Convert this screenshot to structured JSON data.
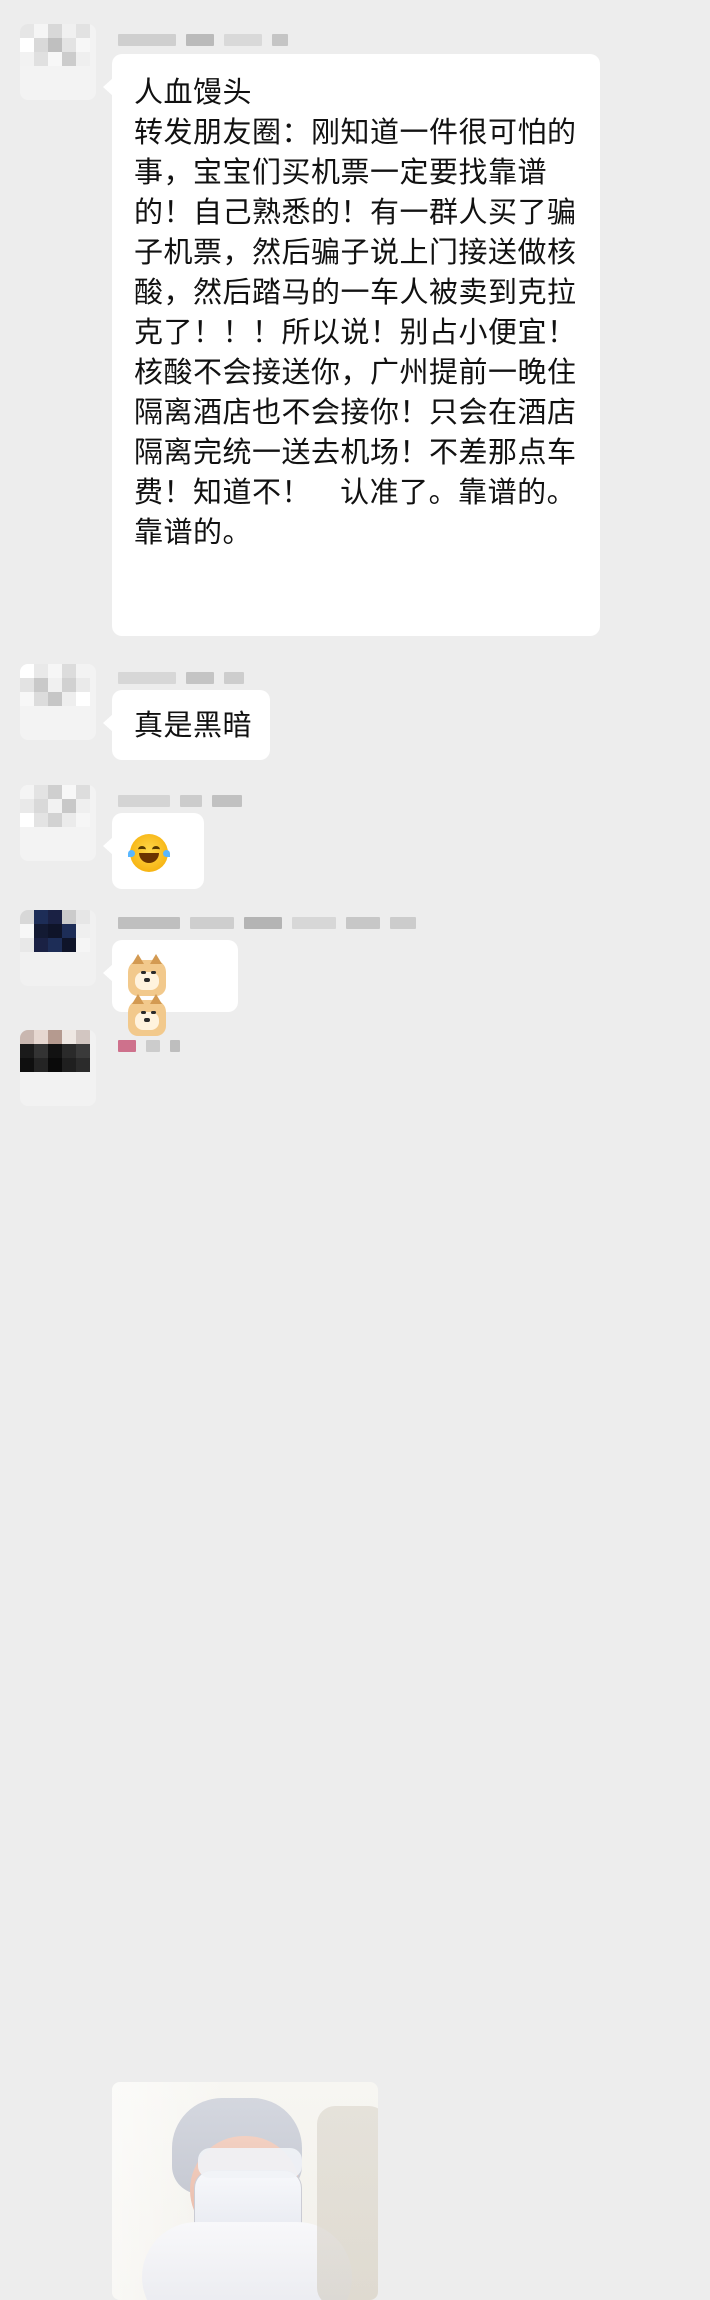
{
  "messages": [
    {
      "type": "text",
      "lines": [
        "人血馒头",
        "",
        "转发朋友圈：刚知道一件很可怕的",
        "事，宝宝们买机票一定要找靠谱",
        "的！自己熟悉的！有一群人买了骗",
        "子机票，然后骗子说上门接送做核",
        "酸，然后踏马的一车人被卖到克拉",
        "克了！！！所以说！别占小便宜！",
        "核酸不会接送你，广州提前一晚住",
        "隔离酒店也不会接你！只会在酒店",
        "隔离完统一送去机场！不差那点车",
        "费！知道不！   认准了。靠谱的。",
        "靠谱的。"
      ]
    },
    {
      "type": "text",
      "lines": [
        "真是黑暗"
      ]
    },
    {
      "type": "emoji",
      "emoji_icon": "tears-of-joy-emoji"
    },
    {
      "type": "emoji",
      "emoji_icons": [
        "doge-emoji",
        "doge-emoji"
      ]
    },
    {
      "type": "image",
      "image_icon": "baby-photo"
    }
  ]
}
